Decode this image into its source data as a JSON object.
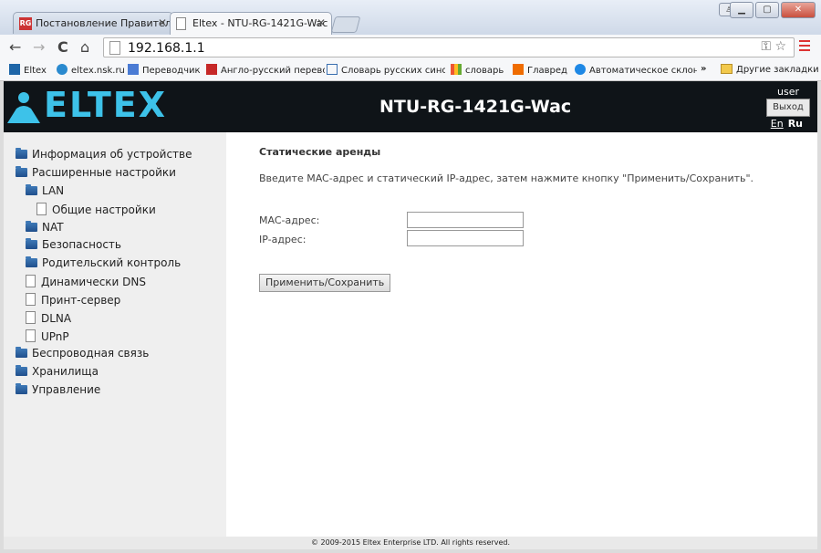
{
  "browser": {
    "tabs": [
      {
        "favicon": "RG",
        "label": "Постановление Правитель",
        "active": false
      },
      {
        "favicon": "page",
        "label": "Eltex - NTU-RG-1421G-Wac",
        "active": true
      }
    ],
    "address": "192.168.1.1",
    "bookmarks": [
      {
        "label": "Eltex",
        "icon": "eltex-icon"
      },
      {
        "label": "eltex.nsk.ru",
        "icon": "eltex-icon"
      },
      {
        "label": "Переводчик",
        "icon": "translate-icon"
      },
      {
        "label": "Англо-русский перевод",
        "icon": "book-icon"
      },
      {
        "label": "Словарь русских сино",
        "icon": "dictionary-icon"
      },
      {
        "label": "словарь",
        "icon": "chart-icon"
      },
      {
        "label": "Главред",
        "icon": "glavred-icon"
      },
      {
        "label": "Автоматическое склоне",
        "icon": "morph-icon"
      },
      {
        "label": "»",
        "icon": ""
      },
      {
        "label": "Другие закладки",
        "icon": "folder-icon"
      }
    ]
  },
  "header": {
    "logo": "ELTEX",
    "device": "NTU-RG-1421G-Wac",
    "user": "user",
    "logout": "Выход",
    "lang_en": "En",
    "lang_ru": "Ru"
  },
  "sidebar": {
    "items": [
      {
        "label": "Информация об устройстве",
        "type": "folder",
        "level": 0
      },
      {
        "label": "Расширенные настройки",
        "type": "folder",
        "level": 0
      },
      {
        "label": "LAN",
        "type": "folder",
        "level": 1
      },
      {
        "label": "Общие настройки",
        "type": "doc",
        "level": 2
      },
      {
        "label": "NAT",
        "type": "folder",
        "level": 1
      },
      {
        "label": "Безопасность",
        "type": "folder",
        "level": 1
      },
      {
        "label": "Родительский контроль",
        "type": "folder",
        "level": 1
      },
      {
        "label": "Динамически DNS",
        "type": "doc",
        "level": 1
      },
      {
        "label": "Принт-сервер",
        "type": "doc",
        "level": 1
      },
      {
        "label": "DLNA",
        "type": "doc",
        "level": 1
      },
      {
        "label": "UPnP",
        "type": "doc",
        "level": 1
      },
      {
        "label": "Беспроводная связь",
        "type": "folder",
        "level": 0
      },
      {
        "label": "Хранилища",
        "type": "folder",
        "level": 0
      },
      {
        "label": "Управление",
        "type": "folder",
        "level": 0
      }
    ]
  },
  "main": {
    "title": "Статические аренды",
    "instruction": "Введите MAC-адрес и статический IP-адрес, затем нажмите кнопку \"Применить/Сохранить\".",
    "mac_label": "MAC-адрес:",
    "mac_value": "",
    "ip_label": "IP-адрес:",
    "ip_value": "",
    "apply_button": "Применить/Сохранить"
  },
  "footer": {
    "text": "© 2009-2015 Eltex Enterprise LTD. All rights reserved."
  },
  "colors": {
    "accent": "#3dc2e9",
    "header_bg": "#0f1418",
    "folder": "#2a64a6"
  }
}
